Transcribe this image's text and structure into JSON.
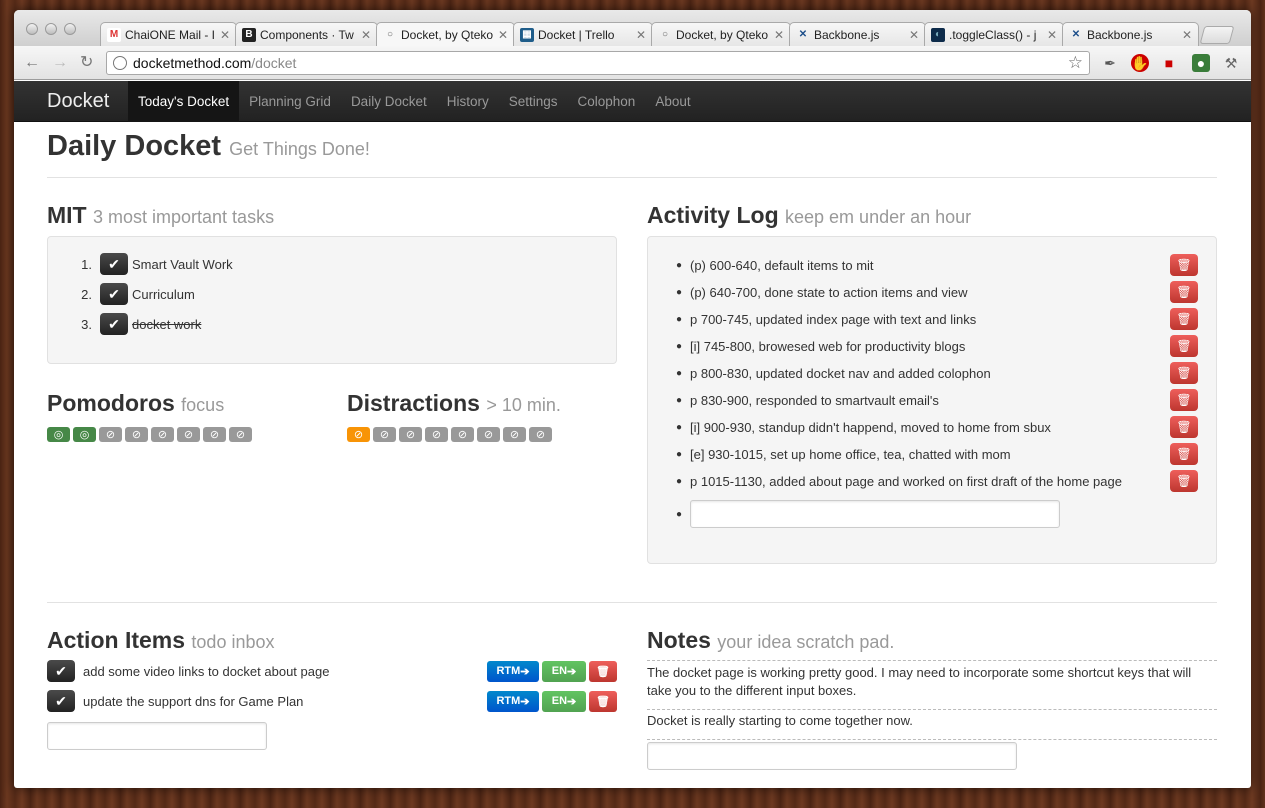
{
  "browser": {
    "tabs": [
      {
        "title": "ChaiONE Mail - I",
        "icon": "gmail-icon"
      },
      {
        "title": "Components · Tw",
        "icon": "bootstrap-icon"
      },
      {
        "title": "Docket, by Qteko",
        "icon": "globe-icon"
      },
      {
        "title": "Docket | Trello",
        "icon": "trello-icon"
      },
      {
        "title": "Docket, by Qteko",
        "icon": "globe-icon"
      },
      {
        "title": "Backbone.js",
        "icon": "backbone-icon"
      },
      {
        "title": ".toggleClass() - j",
        "icon": "jquery-icon"
      },
      {
        "title": "Backbone.js",
        "icon": "backbone-icon"
      }
    ],
    "url_host": "docketmethod.com",
    "url_path": "/docket"
  },
  "nav": {
    "brand": "Docket",
    "links": [
      "Today's Docket",
      "Planning Grid",
      "Daily Docket",
      "History",
      "Settings",
      "Colophon",
      "About"
    ],
    "active": "Today's Docket"
  },
  "page": {
    "title": "Daily Docket",
    "subtitle": "Get Things Done!"
  },
  "mit": {
    "title": "MIT",
    "subtitle": "3 most important tasks",
    "items": [
      {
        "num": "1.",
        "label": "Smart Vault Work",
        "done": false
      },
      {
        "num": "2.",
        "label": "Curriculum",
        "done": false
      },
      {
        "num": "3.",
        "label": "docket work",
        "done": true
      }
    ]
  },
  "pomodoros": {
    "title": "Pomodoros",
    "subtitle": "focus",
    "completed": 2,
    "total": 8
  },
  "distractions": {
    "title": "Distractions",
    "subtitle": "> 10 min.",
    "count": 1,
    "total": 8
  },
  "activity_log": {
    "title": "Activity Log",
    "subtitle": "keep em under an hour",
    "items": [
      "(p) 600-640, default items to mit",
      "(p) 640-700, done state to action items and view",
      "p 700-745, updated index page with text and links",
      "[i] 745-800, browesed web for productivity blogs",
      "p 800-830, updated docket nav and added colophon",
      "p 830-900, responded to smartvault email's",
      "[i] 900-930, standup didn't happend, moved to home from sbux",
      "[e] 930-1015, set up home office, tea, chatted with mom",
      "p 1015-1130, added about page and worked on first draft of the home page"
    ]
  },
  "action_items": {
    "title": "Action Items",
    "subtitle": "todo inbox",
    "items": [
      "add some video links to docket about page",
      "update the support dns for Game Plan"
    ],
    "rtm_label": "RTM",
    "en_label": "EN"
  },
  "notes": {
    "title": "Notes",
    "subtitle": "your idea scratch pad.",
    "items": [
      "The docket page is working pretty good. I may need to incorporate some shortcut keys that will take you to the different input boxes.",
      "Docket is really starting to come together now."
    ]
  },
  "colors": {
    "pomo_done": "#468847",
    "distraction": "#f89406",
    "danger": "#bd362f",
    "rtm": "#0055cc",
    "en": "#51a351"
  }
}
